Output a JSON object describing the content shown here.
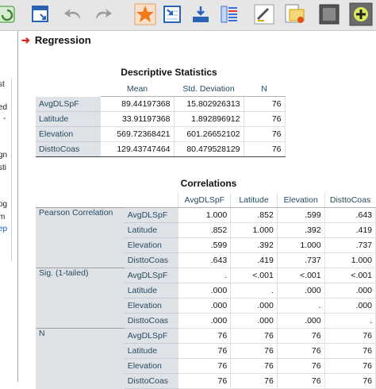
{
  "toolbar": {
    "buttons": [
      {
        "icon": "recall-dialog-icon",
        "color": "#3c8a2e"
      },
      {
        "icon": "data-editor-icon",
        "color": "#2a62b5"
      },
      {
        "icon": "undo-icon",
        "color": "#888888"
      },
      {
        "icon": "redo-icon",
        "color": "#888888"
      },
      {
        "icon": "star-icon",
        "color": "#f07a1a"
      },
      {
        "icon": "goto-case-icon",
        "color": "#2a62b5"
      },
      {
        "icon": "insert-variable-icon",
        "color": "#2a62b5"
      },
      {
        "icon": "variables-icon",
        "color": "#3c6fd6"
      },
      {
        "icon": "edit-output-icon",
        "color": "#555555"
      },
      {
        "icon": "export-icon",
        "color": "#d9a400"
      },
      {
        "icon": "screen-icon",
        "color": "#444444"
      },
      {
        "icon": "add-icon",
        "color": "#2e9c2e"
      }
    ]
  },
  "left_fragments": [
    "st",
    "ed",
    "-",
    "gn",
    "sti",
    "og",
    "m",
    "ep"
  ],
  "section": {
    "title": "Regression"
  },
  "descriptive": {
    "title": "Descriptive Statistics",
    "headers": [
      "Mean",
      "Std. Deviation",
      "N"
    ],
    "rows": [
      {
        "label": "AvgDLSpF",
        "mean": "89.44197368",
        "sd": "15.802926313",
        "n": "76"
      },
      {
        "label": "Latitude",
        "mean": "33.91197368",
        "sd": "1.892896912",
        "n": "76"
      },
      {
        "label": "Elevation",
        "mean": "569.72368421",
        "sd": "601.26652102",
        "n": "76"
      },
      {
        "label": "DisttoCoas",
        "mean": "129.43747464",
        "sd": "80.479528129",
        "n": "76"
      }
    ]
  },
  "correlations": {
    "title": "Correlations",
    "columns": [
      "AvgDLSpF",
      "Latitude",
      "Elevation",
      "DisttoCoas"
    ],
    "groups": [
      {
        "label": "Pearson Correlation",
        "rows": [
          {
            "var": "AvgDLSpF",
            "values": [
              "1.000",
              ".852",
              ".599",
              ".643"
            ]
          },
          {
            "var": "Latitude",
            "values": [
              ".852",
              "1.000",
              ".392",
              ".419"
            ]
          },
          {
            "var": "Elevation",
            "values": [
              ".599",
              ".392",
              "1.000",
              ".737"
            ]
          },
          {
            "var": "DisttoCoas",
            "values": [
              ".643",
              ".419",
              ".737",
              "1.000"
            ]
          }
        ]
      },
      {
        "label": "Sig. (1-tailed)",
        "rows": [
          {
            "var": "AvgDLSpF",
            "values": [
              ".",
              "<.001",
              "<.001",
              "<.001"
            ]
          },
          {
            "var": "Latitude",
            "values": [
              ".000",
              ".",
              ".000",
              ".000"
            ]
          },
          {
            "var": "Elevation",
            "values": [
              ".000",
              ".000",
              ".",
              ".000"
            ]
          },
          {
            "var": "DisttoCoas",
            "values": [
              ".000",
              ".000",
              ".000",
              "."
            ]
          }
        ]
      },
      {
        "label": "N",
        "rows": [
          {
            "var": "AvgDLSpF",
            "values": [
              "76",
              "76",
              "76",
              "76"
            ]
          },
          {
            "var": "Latitude",
            "values": [
              "76",
              "76",
              "76",
              "76"
            ]
          },
          {
            "var": "Elevation",
            "values": [
              "76",
              "76",
              "76",
              "76"
            ]
          },
          {
            "var": "DisttoCoas",
            "values": [
              "76",
              "76",
              "76",
              "76"
            ]
          }
        ]
      }
    ]
  }
}
